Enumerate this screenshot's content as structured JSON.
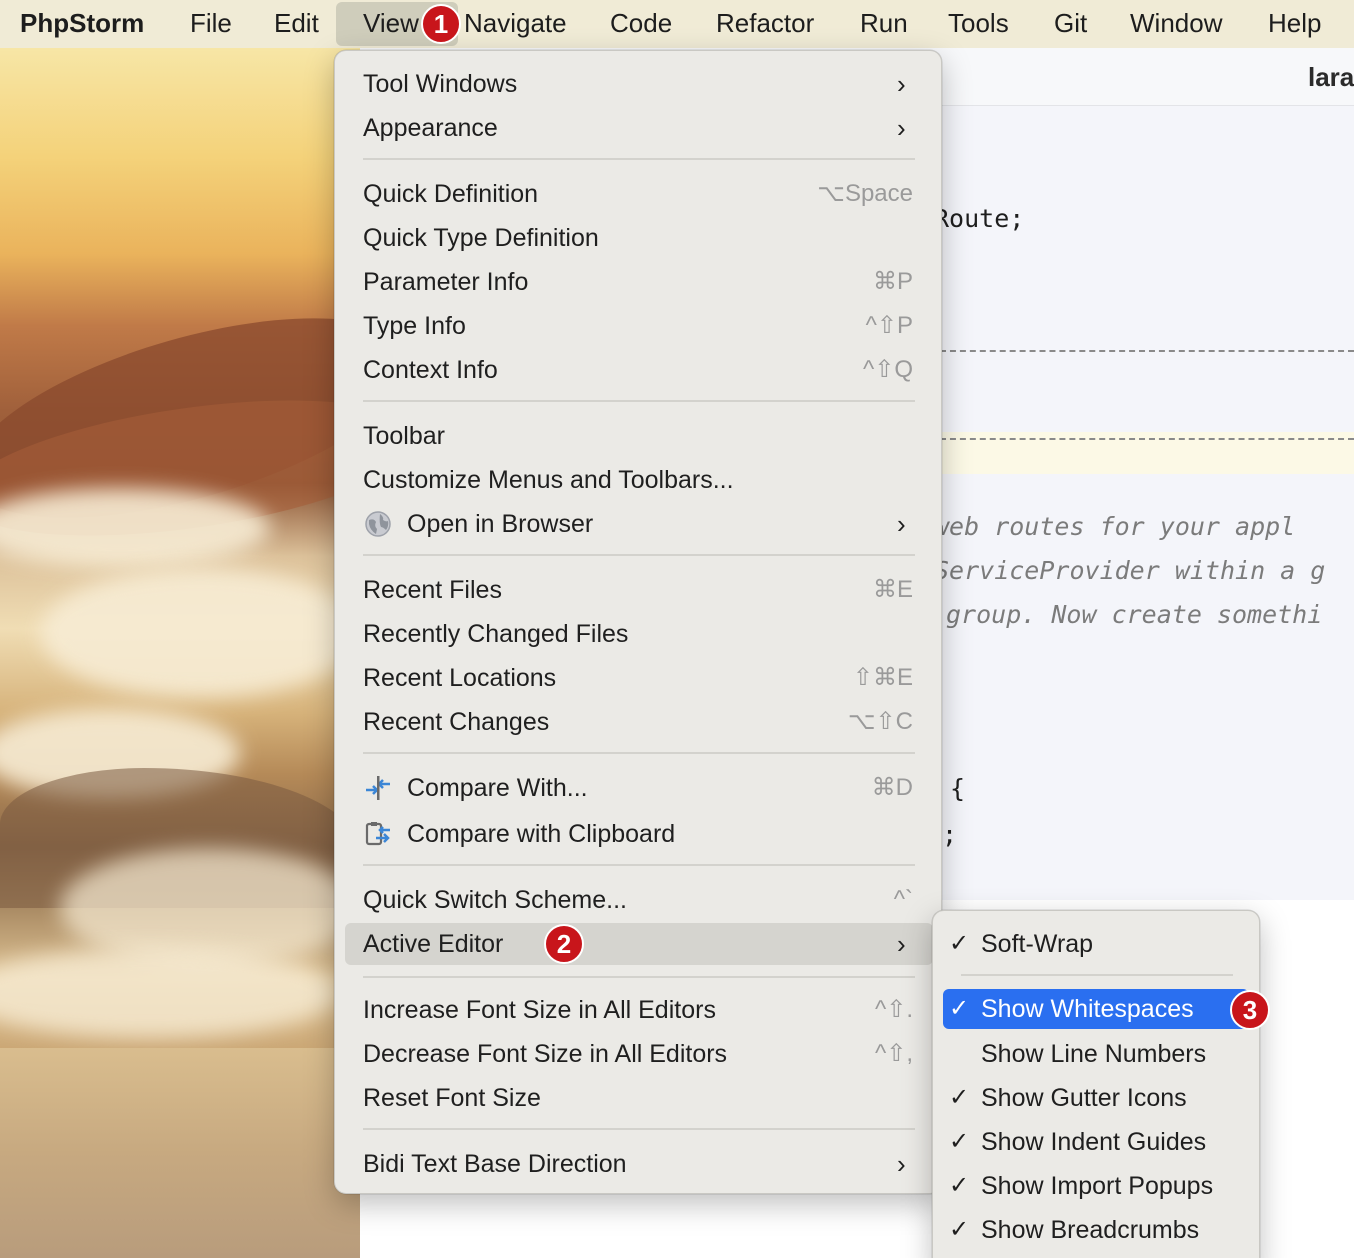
{
  "menubar": {
    "app": "PhpStorm",
    "items": [
      "File",
      "Edit",
      "View",
      "Navigate",
      "Code",
      "Refactor",
      "Run",
      "Tools",
      "Git",
      "Window",
      "Help"
    ]
  },
  "ide": {
    "tab_title": "lara",
    "code_lines": [
      "Route;",
      "web routes for your appl",
      "ServiceProvider within a g",
      "group. Now create somethi",
      "{",
      ";"
    ]
  },
  "view_menu": {
    "tool_windows": "Tool Windows",
    "appearance": "Appearance",
    "quick_definition": "Quick Definition",
    "quick_definition_sc": "⌥Space",
    "quick_type_definition": "Quick Type Definition",
    "parameter_info": "Parameter Info",
    "parameter_info_sc": "⌘P",
    "type_info": "Type Info",
    "type_info_sc": "^⇧P",
    "context_info": "Context Info",
    "context_info_sc": "^⇧Q",
    "toolbar": "Toolbar",
    "customize": "Customize Menus and Toolbars...",
    "open_in_browser": "Open in Browser",
    "recent_files": "Recent Files",
    "recent_files_sc": "⌘E",
    "recently_changed": "Recently Changed Files",
    "recent_locations": "Recent Locations",
    "recent_locations_sc": "⇧⌘E",
    "recent_changes": "Recent Changes",
    "recent_changes_sc": "⌥⇧C",
    "compare_with": "Compare With...",
    "compare_with_sc": "⌘D",
    "compare_clipboard": "Compare with Clipboard",
    "quick_switch": "Quick Switch Scheme...",
    "quick_switch_sc": "^`",
    "active_editor": "Active Editor",
    "increase_font": "Increase Font Size in All Editors",
    "increase_font_sc": "^⇧.",
    "decrease_font": "Decrease Font Size in All Editors",
    "decrease_font_sc": "^⇧,",
    "reset_font": "Reset Font Size",
    "bidi": "Bidi Text Base Direction"
  },
  "active_editor_menu": {
    "soft_wrap": "Soft-Wrap",
    "show_whitespaces": "Show Whitespaces",
    "show_line_numbers": "Show Line Numbers",
    "show_gutter_icons": "Show Gutter Icons",
    "show_indent_guides": "Show Indent Guides",
    "show_import_popups": "Show Import Popups",
    "show_breadcrumbs": "Show Breadcrumbs",
    "check": "✓"
  },
  "callouts": [
    "1",
    "2",
    "3"
  ],
  "colors": {
    "selection": "#2a6ff0",
    "callout": "#c8151b"
  }
}
